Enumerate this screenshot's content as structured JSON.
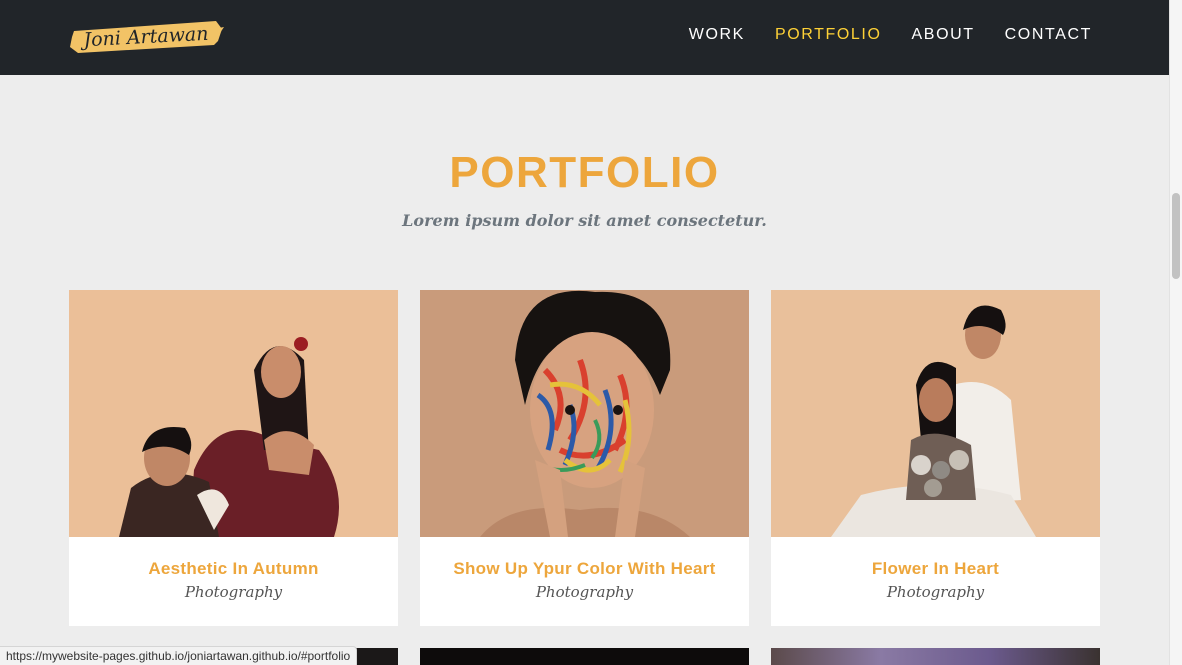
{
  "colors": {
    "navbar_bg": "#212529",
    "page_bg": "#ededed",
    "accent": "#eda63c",
    "nav_active": "#fed136",
    "logo_brush": "#f2c366"
  },
  "brand": {
    "logo_text": "Joni Artawan"
  },
  "nav": {
    "items": [
      {
        "label": "WORK",
        "active": false
      },
      {
        "label": "PORTFOLIO",
        "active": true
      },
      {
        "label": "ABOUT",
        "active": false
      },
      {
        "label": "CONTACT",
        "active": false
      }
    ]
  },
  "portfolio": {
    "heading": "PORTFOLIO",
    "subheading": "Lorem ipsum dolor sit amet consectetur.",
    "items": [
      {
        "title": "Aesthetic In Autumn",
        "caption": "Photography",
        "image": "couple-portrait-photo"
      },
      {
        "title": "Show Up Ypur Color With Heart",
        "caption": "Photography",
        "image": "painted-face-portrait-photo"
      },
      {
        "title": "Flower In Heart",
        "caption": "Photography",
        "image": "couple-flowers-portrait-photo"
      }
    ]
  },
  "status_bar": {
    "url": "https://mywebsite-pages.github.io/joniartawan.github.io/#portfolio"
  }
}
